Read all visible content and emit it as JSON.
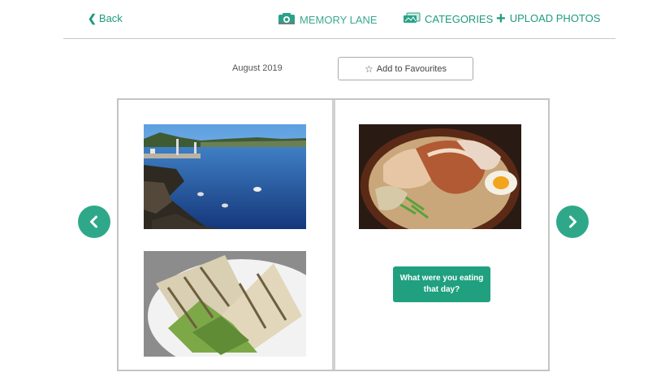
{
  "header": {
    "back_label": "Back",
    "memory_lane_label": "MEMORY LANE",
    "categories_label": "CATEGORIES",
    "upload_label": "UPLOAD PHOTOS"
  },
  "subheader": {
    "date": "August 2019",
    "favourites_label": "Add to Favourites"
  },
  "book": {
    "left_page": {
      "photos": [
        "lake-photo",
        "sandwich-photo"
      ]
    },
    "right_page": {
      "photos": [
        "ramen-photo"
      ],
      "prompt_label": "What were you eating that day?"
    }
  },
  "icons": {
    "back": "chevron-left-icon",
    "memory_lane": "camera-icon",
    "categories": "photos-icon",
    "upload": "plus-icon",
    "favourites": "star-icon",
    "prev": "chevron-left-circle-icon",
    "next": "chevron-right-circle-icon"
  },
  "colors": {
    "accent": "#1f9a80",
    "button": "#20a07f",
    "arrow": "#2fa889"
  }
}
